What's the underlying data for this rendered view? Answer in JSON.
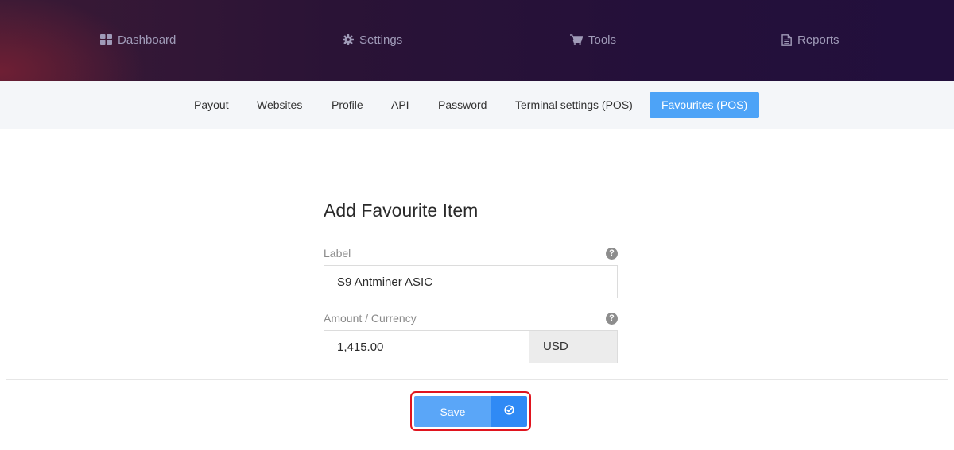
{
  "topnav": {
    "items": [
      {
        "label": "Dashboard",
        "icon": "dashboard-icon"
      },
      {
        "label": "Settings",
        "icon": "gear-icon"
      },
      {
        "label": "Tools",
        "icon": "cart-icon"
      },
      {
        "label": "Reports",
        "icon": "document-icon"
      }
    ]
  },
  "subnav": {
    "tabs": [
      {
        "label": "Payout"
      },
      {
        "label": "Websites"
      },
      {
        "label": "Profile"
      },
      {
        "label": "API"
      },
      {
        "label": "Password"
      },
      {
        "label": "Terminal settings (POS)"
      },
      {
        "label": "Favourites (POS)",
        "active": true
      }
    ]
  },
  "form": {
    "title": "Add Favourite Item",
    "label_field": {
      "label": "Label",
      "value": "S9 Antminer ASIC",
      "help": "?"
    },
    "amount_field": {
      "label": "Amount / Currency",
      "value": "1,415.00",
      "currency": "USD",
      "help": "?"
    },
    "save_label": "Save"
  },
  "colors": {
    "accent": "#4da3f7",
    "save_button": "#5aa6f8",
    "save_icon_button": "#2f8af5",
    "highlight_outline": "#e0141e"
  }
}
